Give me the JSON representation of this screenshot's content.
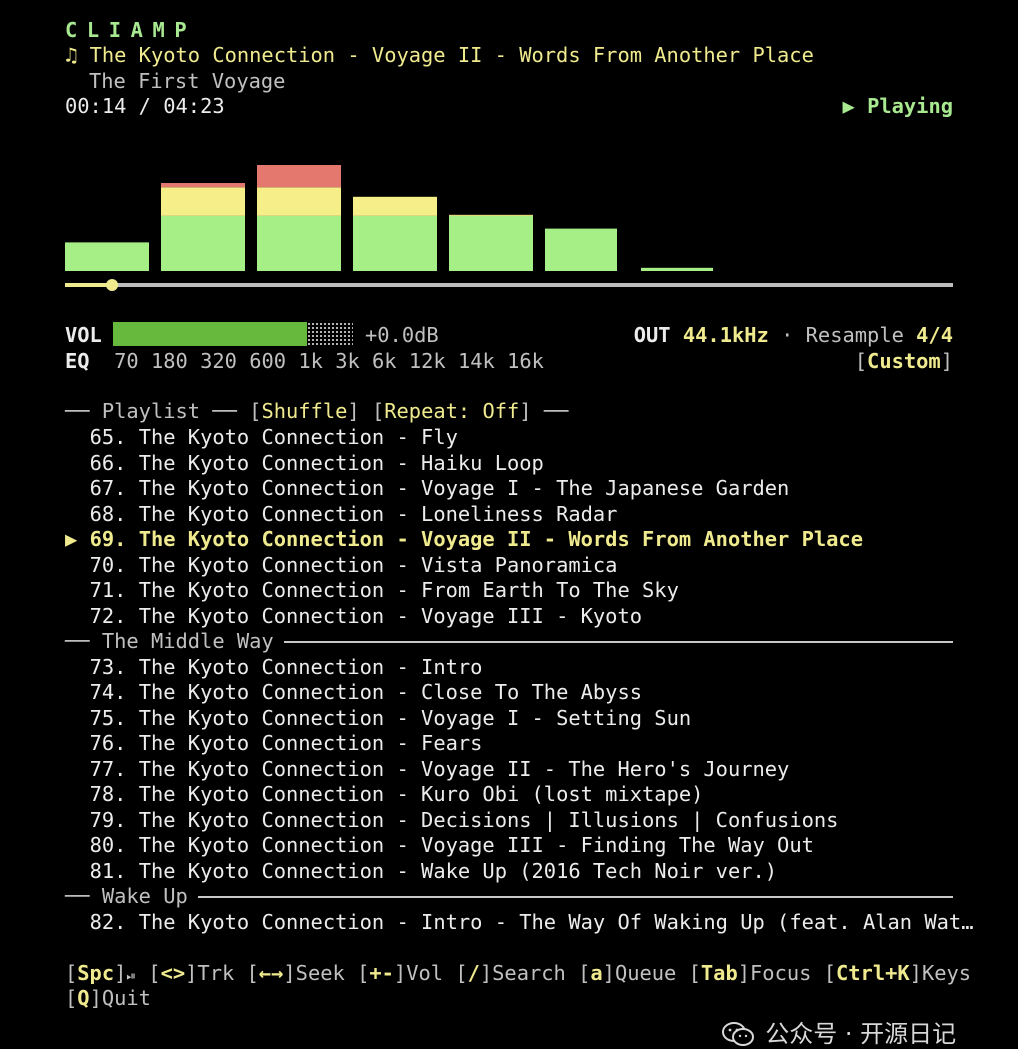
{
  "app": {
    "name": "CLIAMP"
  },
  "now_playing": {
    "note_glyph": "♫",
    "title": "The Kyoto Connection - Voyage II - Words From Another Place",
    "album": "The First Voyage",
    "position": "00:14",
    "duration": "04:23",
    "time_sep": " / ",
    "state_glyph": "▶",
    "state": "Playing"
  },
  "visualizer": {
    "levels": [
      0.27,
      0.83,
      1.0,
      0.7,
      0.53,
      0.4,
      0.03
    ],
    "colors": {
      "low": "#a6ee86",
      "mid": "#f6ee88",
      "high": "#e4786e"
    }
  },
  "seek": {
    "progress": 0.053,
    "colors": {
      "played": "#f0ea8e",
      "rest": "#bdbdbd"
    }
  },
  "volume": {
    "label": "VOL",
    "level": 0.81,
    "readout": "+0.0dB"
  },
  "output": {
    "label": "OUT",
    "rate": "44.1kHz",
    "dot": "·",
    "resample_label": "Resample",
    "resample_value": "4/4"
  },
  "eq": {
    "label": "EQ",
    "bands": [
      "70",
      "180",
      "320",
      "600",
      "1k",
      "3k",
      "6k",
      "12k",
      "14k",
      "16k"
    ],
    "preset_open": "[",
    "preset": "Custom",
    "preset_close": "]"
  },
  "playlist": {
    "header_prefix": "── ",
    "header_title": "Playlist",
    "header_mid": " ── ",
    "shuffle_open": "[",
    "shuffle": "Shuffle",
    "shuffle_close": "]",
    "repeat_open": " [",
    "repeat": "Repeat: Off",
    "repeat_close": "]",
    "header_suffix": " ──",
    "current_marker": "▶",
    "groups": [
      {
        "name": "",
        "tracks": [
          {
            "num": "65.",
            "text": "The Kyoto Connection - Fly"
          },
          {
            "num": "66.",
            "text": "The Kyoto Connection - Haiku Loop"
          },
          {
            "num": "67.",
            "text": "The Kyoto Connection - Voyage I - The Japanese Garden"
          },
          {
            "num": "68.",
            "text": "The Kyoto Connection - Loneliness Radar"
          },
          {
            "num": "69.",
            "text": "The Kyoto Connection - Voyage II - Words From Another Place",
            "current": true
          },
          {
            "num": "70.",
            "text": "The Kyoto Connection - Vista Panoramica"
          },
          {
            "num": "71.",
            "text": "The Kyoto Connection - From Earth To The Sky"
          },
          {
            "num": "72.",
            "text": "The Kyoto Connection - Voyage III - Kyoto"
          }
        ]
      },
      {
        "name": "The Middle Way",
        "tracks": [
          {
            "num": "73.",
            "text": "The Kyoto Connection - Intro"
          },
          {
            "num": "74.",
            "text": "The Kyoto Connection - Close To The Abyss"
          },
          {
            "num": "75.",
            "text": "The Kyoto Connection - Voyage I - Setting Sun"
          },
          {
            "num": "76.",
            "text": "The Kyoto Connection - Fears"
          },
          {
            "num": "77.",
            "text": "The Kyoto Connection - Voyage II - The Hero's Journey"
          },
          {
            "num": "78.",
            "text": "The Kyoto Connection - Kuro Obi (lost mixtape)"
          },
          {
            "num": "79.",
            "text": "The Kyoto Connection - Decisions | Illusions | Confusions"
          },
          {
            "num": "80.",
            "text": "The Kyoto Connection - Voyage III - Finding The Way Out"
          },
          {
            "num": "81.",
            "text": "The Kyoto Connection - Wake Up (2016 Tech Noir ver.)"
          }
        ]
      },
      {
        "name": "Wake Up",
        "tracks": [
          {
            "num": "82.",
            "text": "The Kyoto Connection - Intro - The Way Of Waking Up (feat. Alan Wat…"
          }
        ]
      }
    ],
    "group_prefix": "── "
  },
  "footer": {
    "keys": [
      {
        "key": "Spc",
        "action": "⏯"
      },
      {
        "key": "<>",
        "action": "Trk"
      },
      {
        "key": "←→",
        "action": "Seek"
      },
      {
        "key": "+-",
        "action": "Vol"
      },
      {
        "key": "/",
        "action": "Search"
      },
      {
        "key": "a",
        "action": "Queue"
      },
      {
        "key": "Tab",
        "action": "Focus"
      },
      {
        "key": "Ctrl+K",
        "action": "Keys"
      },
      {
        "key": "Q",
        "action": "Quit"
      }
    ]
  },
  "watermark": {
    "text": "公众号 · 开源日记"
  }
}
